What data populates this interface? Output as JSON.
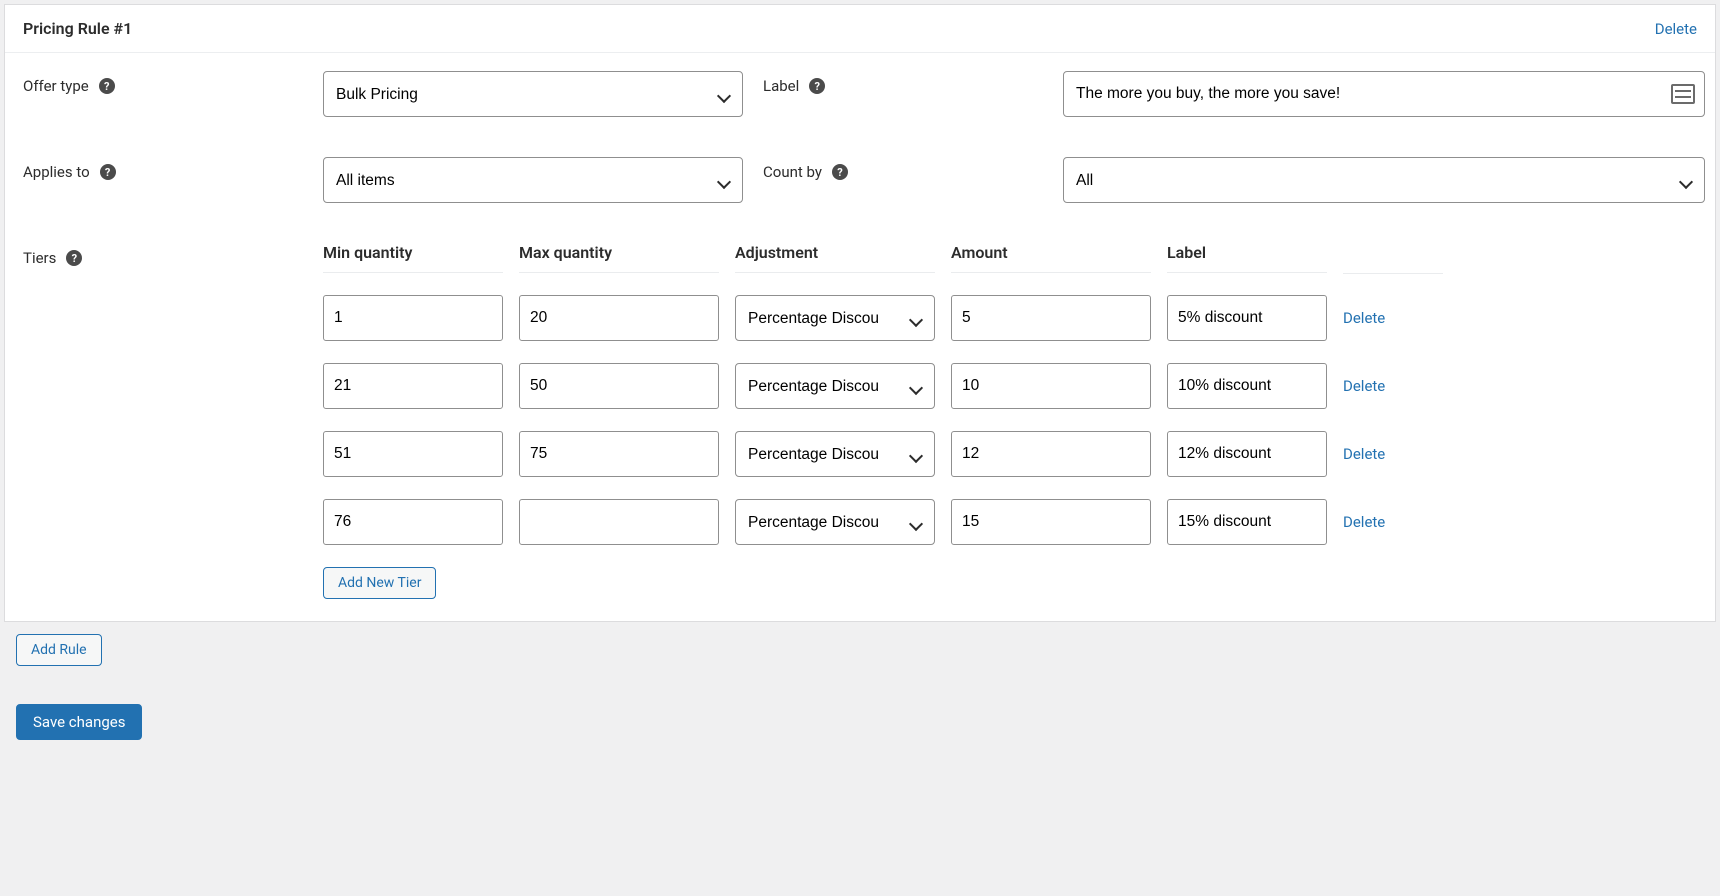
{
  "panel": {
    "title": "Pricing Rule #1",
    "delete_label": "Delete"
  },
  "labels": {
    "offer_type": "Offer type",
    "label": "Label",
    "applies_to": "Applies to",
    "count_by": "Count by",
    "tiers": "Tiers"
  },
  "fields": {
    "offer_type": "Bulk Pricing",
    "label_value": "The more you buy, the more you save!",
    "applies_to": "All items",
    "count_by": "All"
  },
  "tiers_headers": {
    "min_qty": "Min quantity",
    "max_qty": "Max quantity",
    "adjustment": "Adjustment",
    "amount": "Amount",
    "label": "Label"
  },
  "adjustment_option": "Percentage Discou",
  "tiers": [
    {
      "min": "1",
      "max": "20",
      "adjustment": "Percentage Discou",
      "amount": "5",
      "label": "5% discount"
    },
    {
      "min": "21",
      "max": "50",
      "adjustment": "Percentage Discou",
      "amount": "10",
      "label": "10% discount"
    },
    {
      "min": "51",
      "max": "75",
      "adjustment": "Percentage Discou",
      "amount": "12",
      "label": "12% discount"
    },
    {
      "min": "76",
      "max": "",
      "adjustment": "Percentage Discou",
      "amount": "15",
      "label": "15% discount"
    }
  ],
  "buttons": {
    "add_tier": "Add New Tier",
    "add_rule": "Add Rule",
    "save": "Save changes",
    "delete_tier": "Delete"
  }
}
